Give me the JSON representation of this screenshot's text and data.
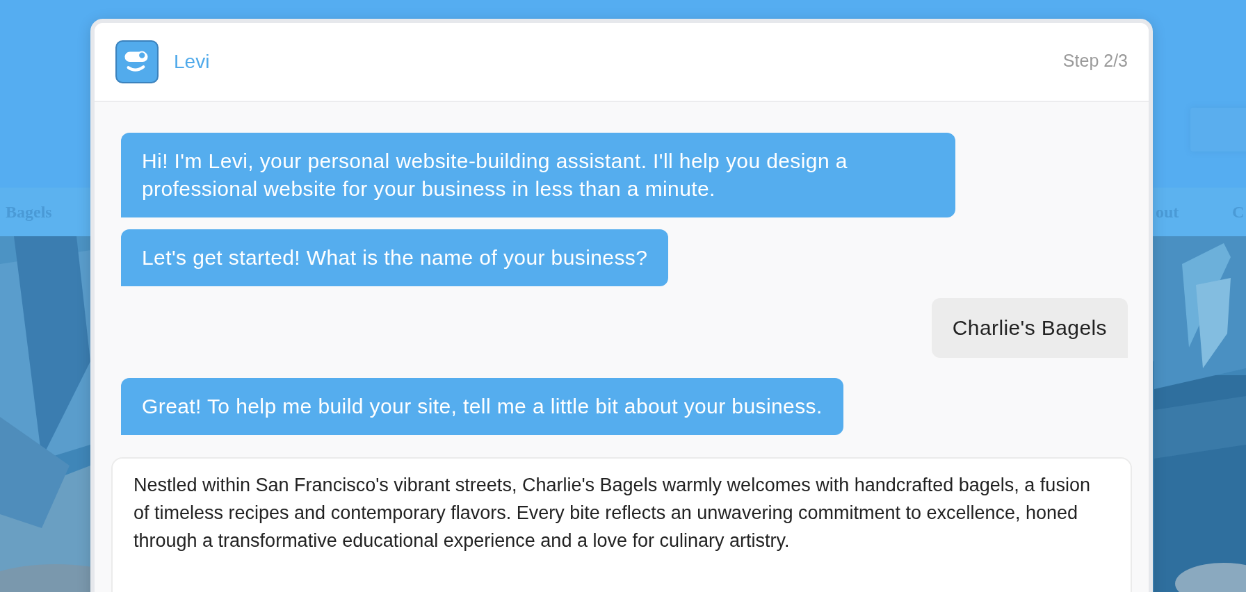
{
  "background": {
    "nav": [
      {
        "label": "Bagels"
      },
      {
        "label": "out"
      },
      {
        "label": "C"
      }
    ]
  },
  "dialog": {
    "assistant_name": "Levi",
    "step": "Step 2/3",
    "messages": [
      {
        "kind": "assistant",
        "text": "Hi! I'm Levi, your personal website-building assistant. I'll help you design a professional website for your business in less than a minute."
      },
      {
        "kind": "assistant",
        "text": "Let's get started! What is the name of your business?"
      },
      {
        "kind": "user",
        "text": "Charlie's Bagels"
      },
      {
        "kind": "assistant",
        "text": "Great! To help me build your site, tell me a little bit about your business."
      }
    ],
    "input": {
      "value": "Nestled within San Francisco's vibrant streets, Charlie's Bagels warmly welcomes with handcrafted bagels, a fusion of timeless recipes and contemporary flavors. Every bite reflects an unwavering commitment to excellence, honed through a transformative educational experience and a love for culinary artistry."
    }
  }
}
